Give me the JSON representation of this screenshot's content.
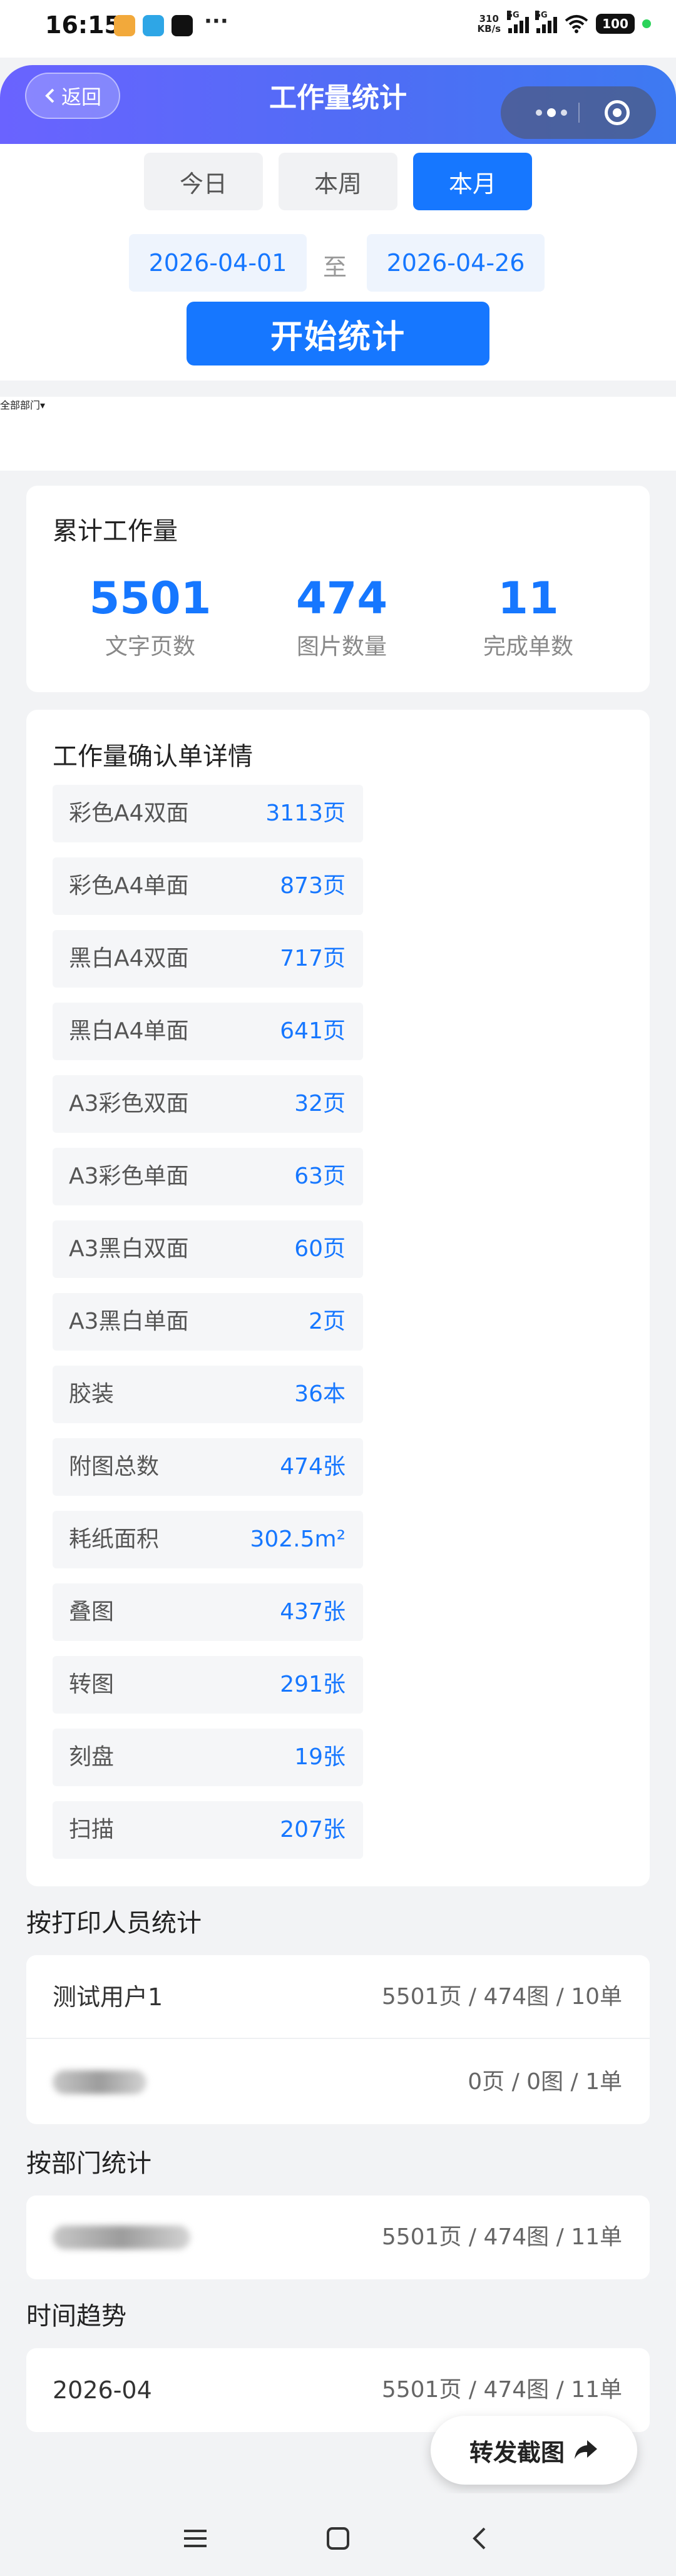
{
  "status_bar": {
    "time": "16:15",
    "more": "···",
    "net_speed_value": "310",
    "net_speed_unit": "KB/s",
    "signal_1": "5G",
    "signal_2": "5G",
    "battery": "100"
  },
  "nav": {
    "back_label": "返回",
    "title": "工作量统计"
  },
  "filter": {
    "tabs": [
      {
        "label": "今日",
        "active": false
      },
      {
        "label": "本周",
        "active": false
      },
      {
        "label": "本月",
        "active": true
      }
    ],
    "start_date": "2026-04-01",
    "to_label": "至",
    "end_date": "2026-04-26",
    "start_button": "开始统计"
  },
  "department": {
    "label": "全部部门▾"
  },
  "summary": {
    "title": "累计工作量",
    "stats": [
      {
        "value": "5501",
        "label": "文字页数"
      },
      {
        "value": "474",
        "label": "图片数量"
      },
      {
        "value": "11",
        "label": "完成单数"
      }
    ]
  },
  "details": {
    "title": "工作量确认单详情",
    "rows": [
      {
        "name": "彩色A4双面",
        "value": "3113页"
      },
      {
        "name": "彩色A4单面",
        "value": "873页"
      },
      {
        "name": "黑白A4双面",
        "value": "717页"
      },
      {
        "name": "黑白A4单面",
        "value": "641页"
      },
      {
        "name": "A3彩色双面",
        "value": "32页"
      },
      {
        "name": "A3彩色单面",
        "value": "63页"
      },
      {
        "name": "A3黑白双面",
        "value": "60页"
      },
      {
        "name": "A3黑白单面",
        "value": "2页"
      },
      {
        "name": "胶装",
        "value": "36本"
      },
      {
        "name": "附图总数",
        "value": "474张"
      },
      {
        "name": "耗纸面积",
        "value": "302.5m²"
      },
      {
        "name": "叠图",
        "value": "437张"
      },
      {
        "name": "转图",
        "value": "291张"
      },
      {
        "name": "刻盘",
        "value": "19张"
      },
      {
        "name": "扫描",
        "value": "207张"
      }
    ]
  },
  "by_printer": {
    "title": "按打印人员统计",
    "rows": [
      {
        "name": "测试用户1",
        "value": "5501页 / 474图 / 10单"
      },
      {
        "name": "",
        "value": "0页 / 0图 / 1单"
      }
    ]
  },
  "by_department": {
    "title": "按部门统计",
    "rows": [
      {
        "name": "",
        "value": "5501页 / 474图 / 11单"
      }
    ]
  },
  "trend": {
    "title": "时间趋势",
    "rows": [
      {
        "name": "2026-04",
        "value": "5501页 / 474图 / 11单"
      }
    ]
  },
  "share_button": "转发截图",
  "colors": {
    "accent": "#1677ff",
    "nav_gradient_start": "#6a63ff",
    "nav_gradient_end": "#3d7af2",
    "page_bg": "#f2f3f5"
  }
}
